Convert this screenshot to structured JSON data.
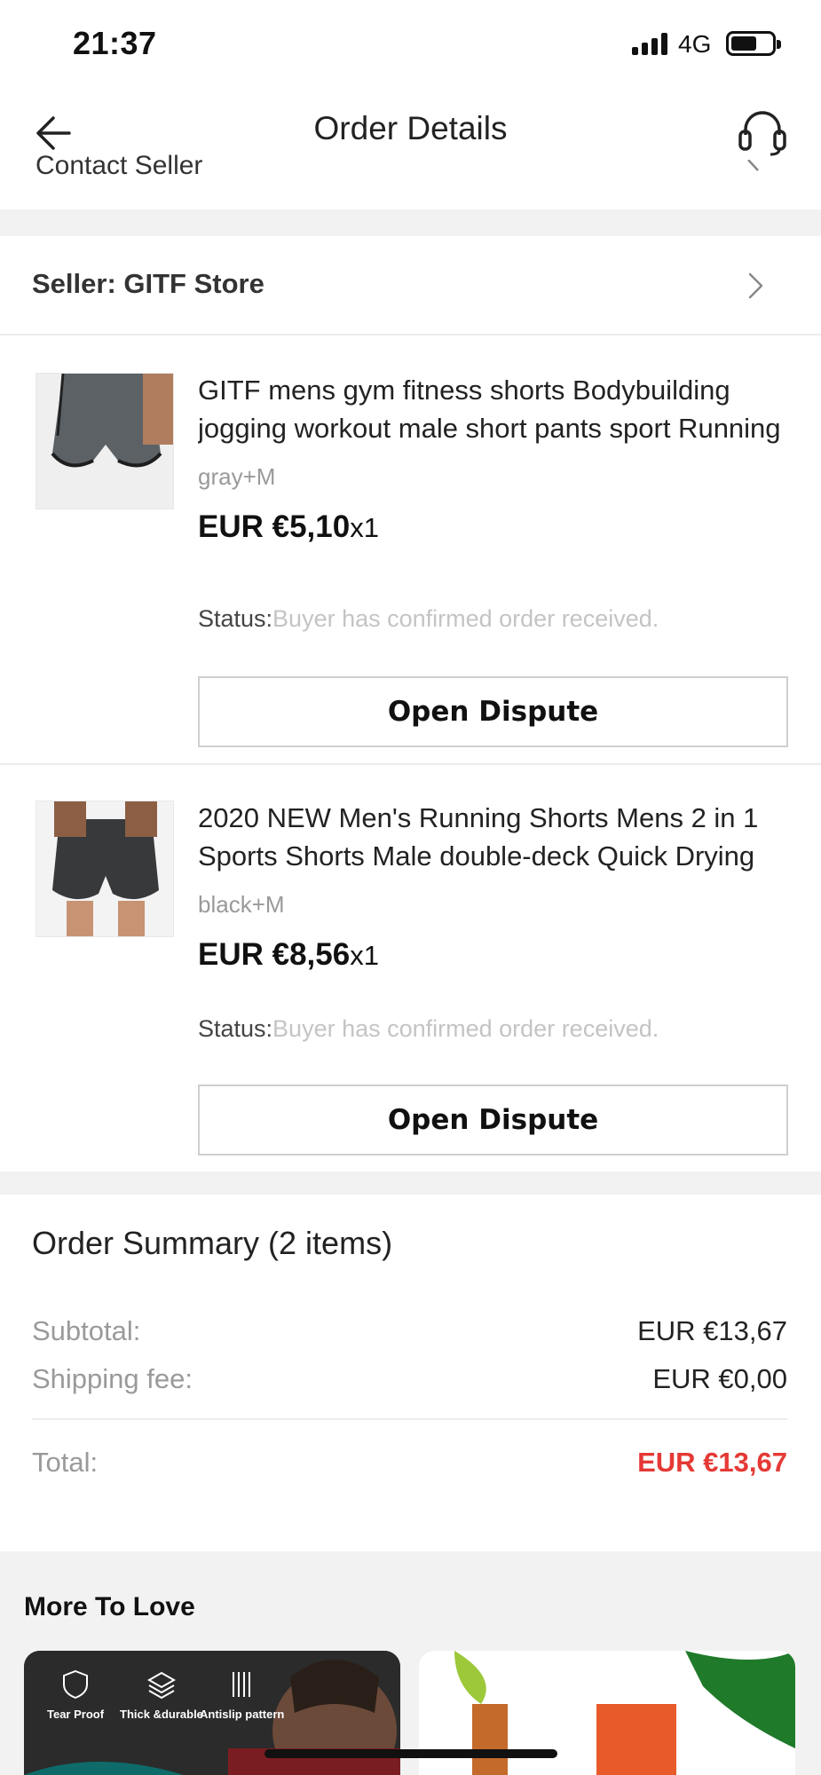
{
  "status_bar": {
    "time": "21:37",
    "network": "4G"
  },
  "nav": {
    "title": "Order Details",
    "partial_row_text": "Contact Seller"
  },
  "seller": {
    "label": "Seller: GITF Store"
  },
  "items": [
    {
      "title_line1": "GITF mens gym fitness shorts Bodybuilding",
      "title_line2": "jogging workout male short pants sport Running",
      "variant": "gray+M",
      "price": "EUR €5,10",
      "qty": "x1",
      "status_label": "Status:",
      "status_value": "Buyer has confirmed order received.",
      "dispute_label": "Open Dispute"
    },
    {
      "title_line1": "2020 NEW Men's Running Shorts Mens 2 in 1",
      "title_line2": "Sports Shorts Male double-deck Quick Drying",
      "variant": "black+M",
      "price": "EUR €8,56",
      "qty": "x1",
      "status_label": "Status:",
      "status_value": "Buyer has confirmed order received.",
      "dispute_label": "Open Dispute"
    }
  ],
  "summary": {
    "title": "Order Summary (2 items)",
    "subtotal_label": "Subtotal:",
    "subtotal_value": "EUR €13,67",
    "shipping_label": "Shipping fee:",
    "shipping_value": "EUR €0,00",
    "total_label": "Total:",
    "total_value": "EUR €13,67",
    "total_color": "#e53935"
  },
  "more_to_love": {
    "title": "More To Love",
    "features": [
      "Tear Proof",
      "Thick &durable",
      "Antislip pattern"
    ]
  }
}
